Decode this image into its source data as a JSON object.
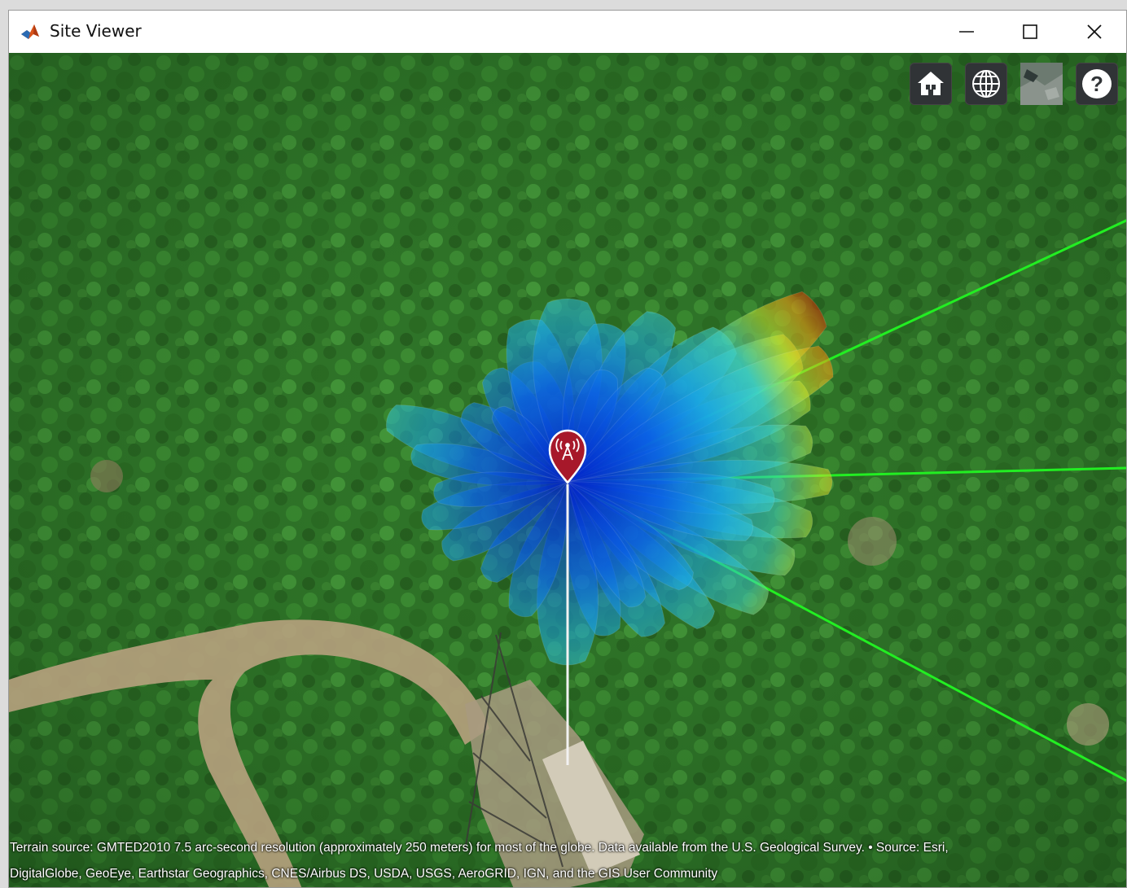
{
  "window": {
    "title": "Site Viewer",
    "controls": [
      "minimize",
      "maximize",
      "close"
    ]
  },
  "toolbar": {
    "buttons": [
      {
        "name": "home",
        "icon": "home-icon"
      },
      {
        "name": "globe",
        "icon": "globe-icon"
      },
      {
        "name": "basemap",
        "icon": "basemap-thumbnail"
      },
      {
        "name": "help",
        "icon": "help-icon",
        "label": "?"
      }
    ]
  },
  "map": {
    "basemap": "satellite",
    "site_marker_icon": "transmitter-icon",
    "colors": {
      "marker": "#a7182a",
      "los_line": "#22ee22",
      "pattern_colormap": [
        "#0022cc",
        "#0088ee",
        "#33ccdd",
        "#cce833",
        "#ff9900",
        "#cc1100"
      ]
    }
  },
  "attribution": {
    "line1": "Terrain source: GMTED2010 7.5 arc-second resolution (approximately 250 meters) for most of the globe. Data available from the U.S. Geological Survey. • Source: Esri,",
    "line2": "DigitalGlobe, GeoEye, Earthstar Geographics, CNES/Airbus DS, USDA, USGS, AeroGRID, IGN, and the GIS User Community"
  }
}
